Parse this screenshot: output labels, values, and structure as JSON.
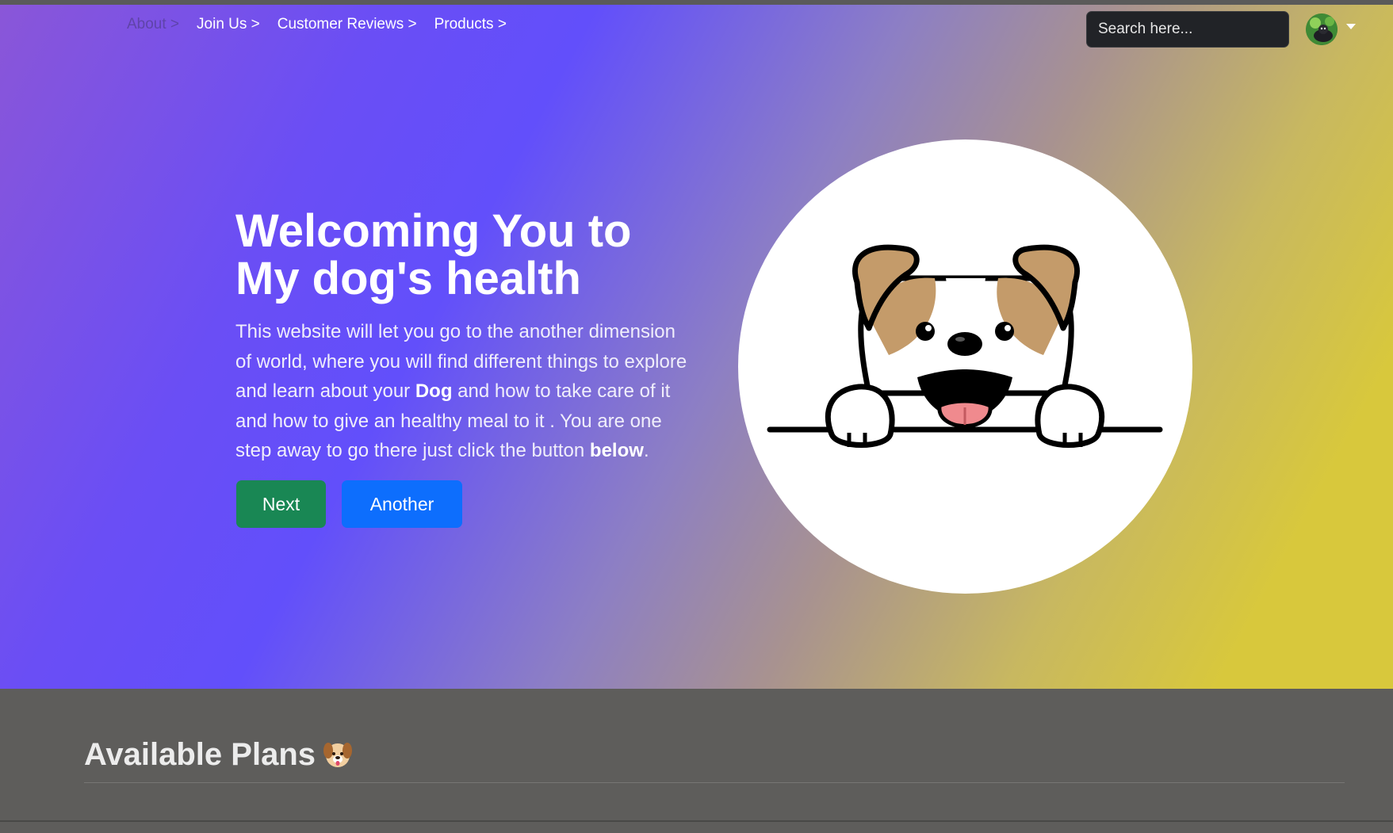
{
  "navbar": {
    "links": [
      {
        "label": "About >"
      },
      {
        "label": "Join Us >"
      },
      {
        "label": "Customer Reviews >"
      },
      {
        "label": "Products >"
      }
    ],
    "search_placeholder": "Search here..."
  },
  "hero": {
    "title_line1": "Welcoming You to",
    "title_line2": "My dog's health",
    "text_part1": "This website will let you go to the another dimension of world, where you will find different things to explore and learn about your ",
    "text_bold1": "Dog",
    "text_part2": " and how to take care of it and how to give an healthy meal to it . You are one step away to go there just click the button ",
    "text_bold2": "below",
    "text_end": ".",
    "next_label": "Next",
    "another_label": "Another"
  },
  "plans": {
    "title": "Available Plans"
  },
  "colors": {
    "next_button": "#198754",
    "another_button": "#0d6efd",
    "footer_bg": "#5e5d5b"
  },
  "icons": {
    "hero_image": "dog-face-illustration",
    "plans_emoji": "dog-face-emoji",
    "avatar": "user-avatar"
  }
}
